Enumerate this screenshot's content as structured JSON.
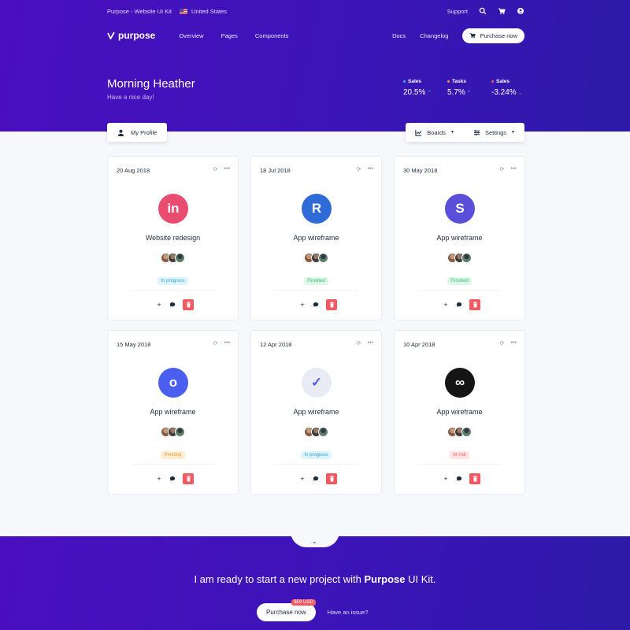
{
  "topbar": {
    "kit_label": "Purpose - Website UI Kit",
    "country": "United States",
    "support": "Support"
  },
  "navbar": {
    "brand": "purpose",
    "links": [
      "Overview",
      "Pages",
      "Components"
    ],
    "docs": "Docs",
    "changelog": "Changelog",
    "purchase": "Purchase now"
  },
  "greeting": {
    "title": "Morning Heather",
    "subtitle": "Have a nice day!"
  },
  "stats": [
    {
      "label": "Sales",
      "value": "20.5%",
      "dot_color": "#3fb4e8",
      "arrow": "^",
      "arrow_color": "#3fd6a6"
    },
    {
      "label": "Tasks",
      "value": "5.7%",
      "dot_color": "#ff8a57",
      "arrow": "^",
      "arrow_color": "#3fd6a6"
    },
    {
      "label": "Sales",
      "value": "-3.24%",
      "dot_color": "#f25961",
      "arrow": "v",
      "arrow_color": "#f25961"
    }
  ],
  "tools": {
    "profile": "My Profile",
    "boards": "Boards",
    "settings": "Settings"
  },
  "cards": [
    {
      "date": "20 Aug 2018",
      "title": "Website redesign",
      "status": "In progress",
      "logo_text": "in",
      "logo_bg": "#ea4c6f",
      "status_bg": "#dff4fc",
      "status_color": "#2fa7d8"
    },
    {
      "date": "18 Jul 2018",
      "title": "App wireframe",
      "status": "Finished",
      "logo_text": "R",
      "logo_bg": "#2f6bd8",
      "status_bg": "#def7e8",
      "status_color": "#2fbf71"
    },
    {
      "date": "30 May 2018",
      "title": "App wireframe",
      "status": "Finished",
      "logo_text": "S",
      "logo_bg": "#5a4fd8",
      "status_bg": "#def7e8",
      "status_color": "#2fbf71"
    },
    {
      "date": "15 May 2018",
      "title": "App wireframe",
      "status": "Pending",
      "logo_text": "o",
      "logo_bg": "#4a5ff0",
      "status_bg": "#ffeed3",
      "status_color": "#e89a2b"
    },
    {
      "date": "12 Apr 2018",
      "title": "App wireframe",
      "status": "In progress",
      "logo_text": "✓",
      "logo_bg": "#e9ecf4",
      "status_bg": "#dff4fc",
      "status_color": "#2fa7d8"
    },
    {
      "date": "10 Apr 2018",
      "title": "App wireframe",
      "status": "At risk",
      "logo_text": "∞",
      "logo_bg": "#151515",
      "status_bg": "#ffe3e5",
      "status_color": "#f25961"
    }
  ],
  "cta": {
    "lead": "I am ready to start a new project with",
    "brand": "Purpose",
    "tail": "UI Kit.",
    "button": "Purchase now",
    "price": "$59 USD",
    "issue": "Have an issue?"
  }
}
